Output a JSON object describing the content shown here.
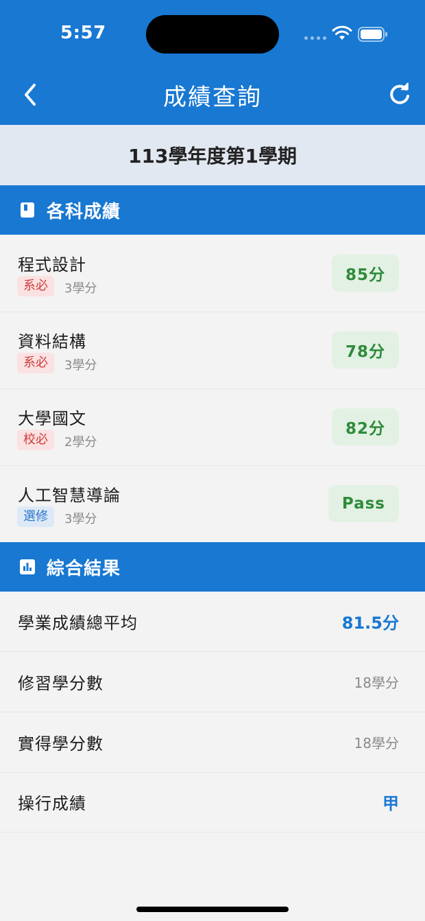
{
  "status_bar": {
    "time": "5:57"
  },
  "nav": {
    "title": "成績查詢",
    "back_icon": "chevron-left-icon",
    "refresh_icon": "refresh-icon"
  },
  "semester": "113學年度第1學期",
  "courses_section": {
    "title": "各科成績",
    "icon": "book-icon"
  },
  "courses": [
    {
      "name": "程式設計",
      "tag": "系必",
      "tag_type": "required",
      "credits": "3學分",
      "score": "85分"
    },
    {
      "name": "資料結構",
      "tag": "系必",
      "tag_type": "required",
      "credits": "3學分",
      "score": "78分"
    },
    {
      "name": "大學國文",
      "tag": "校必",
      "tag_type": "required",
      "credits": "2學分",
      "score": "82分"
    },
    {
      "name": "人工智慧導論",
      "tag": "選修",
      "tag_type": "elective",
      "credits": "3學分",
      "score": "Pass"
    }
  ],
  "summary_section": {
    "title": "綜合結果",
    "icon": "bar-chart-icon"
  },
  "summary": [
    {
      "label": "學業成績總平均",
      "value": "81.5分"
    },
    {
      "label": "修習學分數",
      "value": "18學分"
    },
    {
      "label": "實得學分數",
      "value": "18學分"
    },
    {
      "label": "操行成績",
      "value": "甲"
    }
  ],
  "colors": {
    "primary": "#1878d2",
    "score_bg": "#e2f1e3",
    "score_text": "#2e8b3a",
    "required_bg": "#fbe2e2",
    "required_text": "#d03b3b",
    "elective_bg": "#dde9f7",
    "elective_text": "#2b76c9"
  }
}
